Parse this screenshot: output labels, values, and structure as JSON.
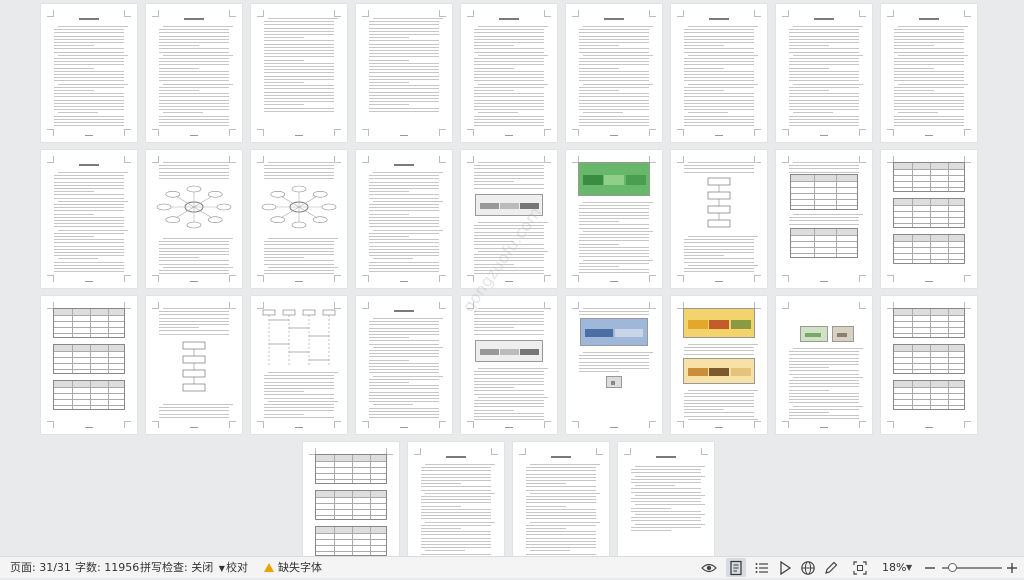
{
  "statusbar": {
    "page_label": "页面: 31/31",
    "word_count_label": "字数: 11956",
    "spellcheck_label": "拼写检查: 关闭",
    "proofread_label": "校对",
    "missing_font_label": "缺失字体",
    "zoom_percent": "18%"
  },
  "icons": {
    "eye": "eye-icon",
    "page_view": "page-view-icon",
    "outline": "outline-icon",
    "play": "play-icon",
    "web": "globe-icon",
    "pen": "pen-icon",
    "fit": "fit-window-icon",
    "minus": "zoom-out-icon",
    "plus": "zoom-in-icon",
    "warning": "warning-icon",
    "dropdown": "chevron-down-icon"
  },
  "document": {
    "page_count": 31,
    "watermark": "gongzuofu.com"
  },
  "colors": {
    "statusbar_bg": "#f4f4f5",
    "canvas_bg": "#e9eaec",
    "warning": "#e9a400",
    "active_view": "#d8dbe2"
  }
}
